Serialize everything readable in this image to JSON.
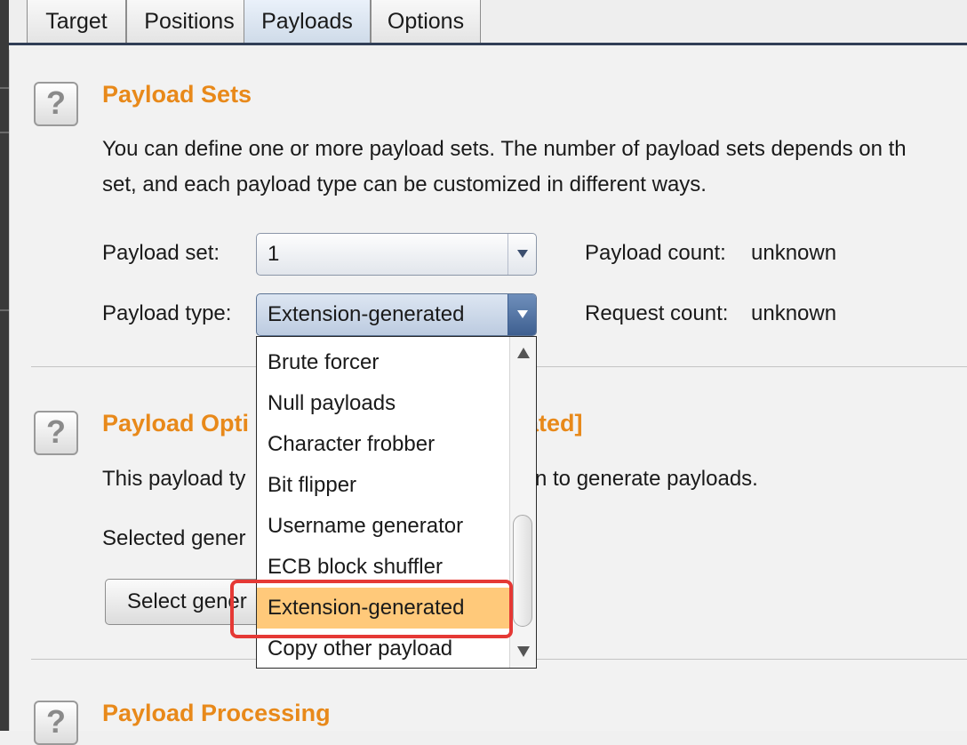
{
  "tabs": [
    {
      "label": "Target"
    },
    {
      "label": "Positions"
    },
    {
      "label": "Payloads"
    },
    {
      "label": "Options"
    }
  ],
  "payload_sets": {
    "help": "?",
    "title": "Payload Sets",
    "description_line1": "You can define one or more payload sets. The number of payload sets depends on th",
    "description_line2": "set, and each payload type can be customized in different ways.",
    "set_label": "Payload set:",
    "set_value": "1",
    "type_label": "Payload type:",
    "type_value": "Extension-generated",
    "payload_count_label": "Payload count:",
    "payload_count_value": "unknown",
    "request_count_label": "Request count:",
    "request_count_value": "unknown"
  },
  "payload_options": {
    "help": "?",
    "title_left": "Payload Opti",
    "title_right": "ated]",
    "desc_left": "This payload ty",
    "desc_right": "n to generate payloads.",
    "selected_label": "Selected gener",
    "select_button": "Select gener"
  },
  "payload_processing": {
    "help": "?",
    "title": "Payload Processing"
  },
  "dropdown": {
    "options": [
      "Brute forcer",
      "Null payloads",
      "Character frobber",
      "Bit flipper",
      "Username generator",
      "ECB block shuffler",
      "Extension-generated",
      "Copy other payload"
    ],
    "selected": "Extension-generated"
  },
  "colors": {
    "heading": "#e8891a",
    "selected_option": "#ffc97a",
    "annotation": "#e53935"
  }
}
